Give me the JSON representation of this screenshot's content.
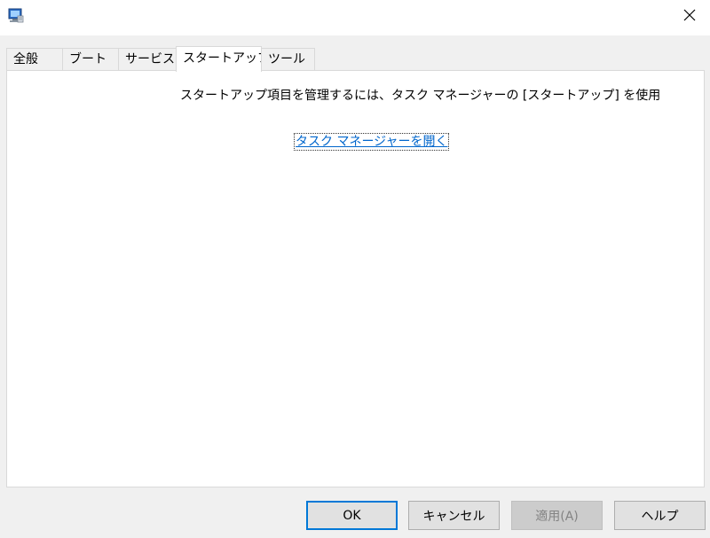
{
  "window": {
    "app_icon": "msconfig-computer-icon",
    "close_icon": "close-icon"
  },
  "tabs": [
    {
      "label": "全般",
      "active": false
    },
    {
      "label": "ブート",
      "active": false
    },
    {
      "label": "サービス",
      "active": false
    },
    {
      "label": "スタートアップ",
      "active": true
    },
    {
      "label": "ツール",
      "active": false
    }
  ],
  "startup": {
    "message": "スタートアップ項目を管理するには、タスク マネージャーの [スタートアップ] を使用してく",
    "link": "タスク マネージャーを開く"
  },
  "buttons": {
    "ok": "OK",
    "cancel": "キャンセル",
    "apply": "適用(A)",
    "help": "ヘルプ"
  },
  "colors": {
    "link": "#0066cc",
    "default_button_border": "#0078d7"
  }
}
